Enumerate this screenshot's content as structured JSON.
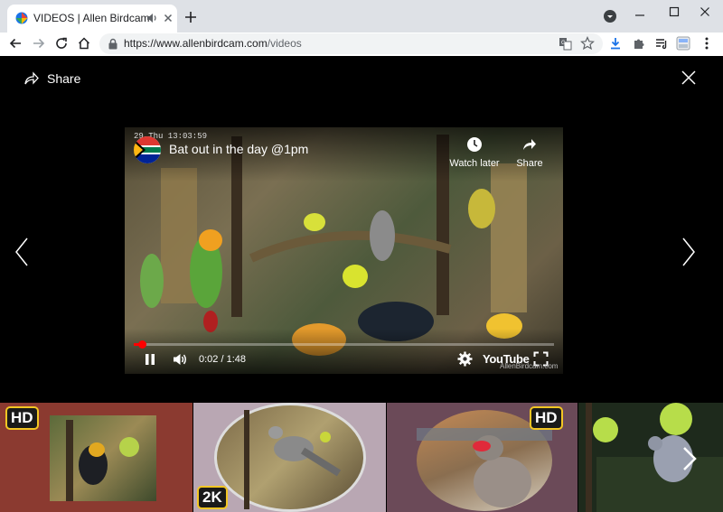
{
  "browser": {
    "tab_title": "VIDEOS | Allen Birdcam",
    "url_domain": "https://www.allenbirdcam.com",
    "url_path": "/videos"
  },
  "lightbox": {
    "share_label": "Share",
    "video": {
      "cam_stamp": "29 Thu 13:03:59",
      "title": "Bat out in the day @1pm",
      "watch_later_label": "Watch later",
      "share_label": "Share",
      "time": "0:02 / 1:48",
      "progress_fraction": 0.02,
      "youtube_label": "YouTube",
      "watermark": "AllenBirdcam.com"
    }
  },
  "thumbnails": [
    {
      "badge": "HD",
      "bg": "#8b3a30"
    },
    {
      "badge": "2K",
      "bg": "#b9a7b3"
    },
    {
      "badge": "HD",
      "bg": "#6b4a58"
    },
    {
      "badge": "",
      "bg": "#1e2a1c"
    }
  ],
  "colors": {
    "accent_badge": "#f3c623",
    "progress": "#ff0000"
  }
}
